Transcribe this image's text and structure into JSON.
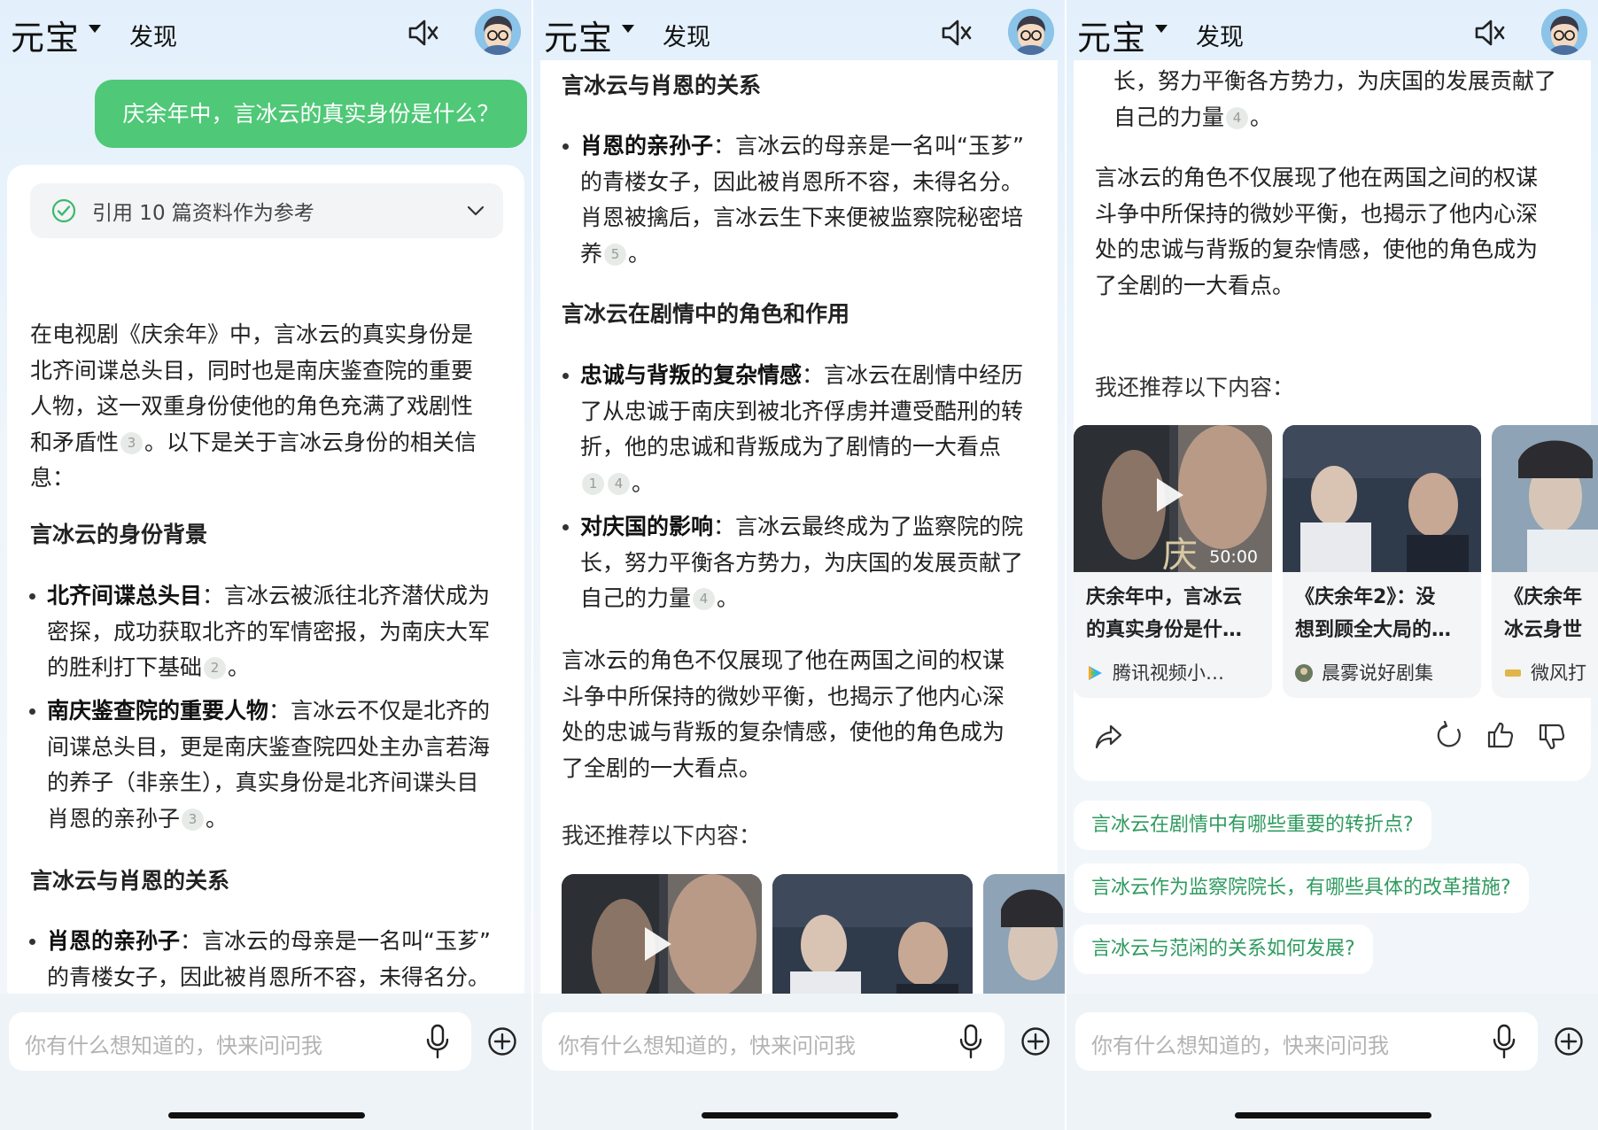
{
  "app": {
    "logo": "元宝",
    "discover": "发现",
    "input_placeholder": "你有什么想知道的，快来问问我"
  },
  "colors": {
    "accent_green": "#4fc877",
    "suggestion_text": "#2f9b5f",
    "background": "#eaf3fb"
  },
  "icons": [
    "mute-icon",
    "avatar",
    "check-circle-icon",
    "chevron-down-icon",
    "play-icon",
    "share-icon",
    "refresh-icon",
    "thumbs-up-icon",
    "thumbs-down-icon",
    "mic-icon",
    "plus-circle-icon"
  ],
  "user_question": "庆余年中，言冰云的真实身份是什么？",
  "reference": "引用 10 篇资料作为参考",
  "answer": {
    "intro": [
      "在电视剧《庆余年》中，言冰云的真实身份是",
      "北齐间谍总头目，同时也是南庆鉴查院的重要",
      "人物，这一双重身份使他的角色充满了戏剧性",
      "和矛盾性",
      "。以下是关于言冰云身份的相关信",
      "息："
    ],
    "sec1_title": "言冰云的身份背景",
    "b1_title": "北齐间谍总头目",
    "b1_lines": [
      "：言冰云被派往北齐潜伏成为",
      "密探，成功获取北齐的军情密报，为南庆大军",
      "的胜利打下基础",
      "。"
    ],
    "b2_title": "南庆鉴查院的重要人物",
    "b2_lines": [
      "：言冰云不仅是北齐的",
      "间谍总头目，更是南庆鉴查院四处主办言若海",
      "的养子（非亲生），真实身份是北齐间谍头目",
      "肖恩的亲孙子",
      "。"
    ],
    "sec2_title": "言冰云与肖恩的关系",
    "b3_title": "肖恩的亲孙子",
    "b3_lines": [
      "：言冰云的母亲是一名叫“玉芗”",
      "的青楼女子，因此被肖恩所不容，未得名分。",
      "肖恩被擒后，言冰云生下来便被监察院秘密培",
      "养",
      "。"
    ],
    "sec3_title": "言冰云在剧情中的角色和作用",
    "b4_title": "忠诚与背叛的复杂情感",
    "b4_lines": [
      "：言冰云在剧情中经历",
      "了从忠诚于南庆到被北齐俘虏并遭受酷刑的转",
      "折，他的忠诚和背叛成为了剧情的一大看点",
      "。"
    ],
    "b5_title": "对庆国的影响",
    "b5_lines": [
      "：言冰云最终成为了监察院的院",
      "长，努力平衡各方势力，为庆国的发展贡献了",
      "自己的力量",
      "。"
    ],
    "conclusion": [
      "言冰云的角色不仅展现了他在两国之间的权谋",
      "斗争中所保持的微妙平衡，也揭示了他内心深",
      "处的忠诚与背叛的复杂情感，使他的角色成为",
      "了全剧的一大看点。"
    ],
    "recommend_title": "我还推荐以下内容："
  },
  "citations": {
    "c1": "1",
    "c2": "2",
    "c3": "3",
    "c4": "4",
    "c5": "5"
  },
  "videos": [
    {
      "title_line1": "庆余年中，言冰云",
      "title_line2": "的真实身份是什…",
      "source": "腾讯视频小…",
      "duration": "50:00"
    },
    {
      "title_line1": "《庆余年2》：没",
      "title_line2": "想到顾全大局的…",
      "source": "晨雾说好剧集"
    },
    {
      "title_line1": "《庆余年",
      "title_line2": "冰云身世",
      "source": "微风打"
    }
  ],
  "suggestions": [
    "言冰云在剧情中有哪些重要的转折点?",
    "言冰云作为监察院院长，有哪些具体的改革措施?",
    "言冰云与范闲的关系如何发展?"
  ]
}
